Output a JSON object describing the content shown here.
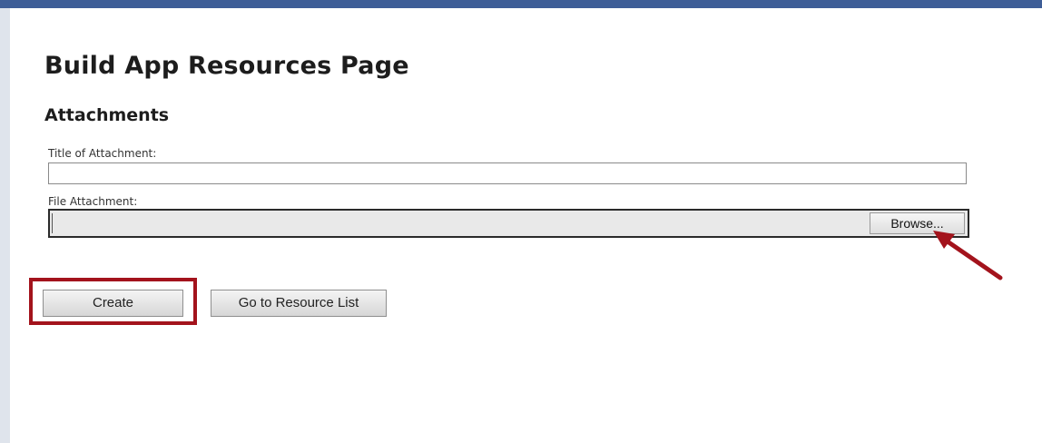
{
  "page": {
    "title": "Build App Resources Page",
    "section": "Attachments"
  },
  "form": {
    "title_label": "Title of Attachment:",
    "title_value": "",
    "file_label": "File Attachment:",
    "file_value": "",
    "browse_label": "Browse..."
  },
  "actions": {
    "create_label": "Create",
    "resource_list_label": "Go to Resource List"
  },
  "annotations": {
    "highlight_target": "create-button",
    "arrow_target": "browse-button",
    "color": "#a3131c"
  },
  "colors": {
    "top_bar": "#3e5e97",
    "left_gutter": "#dfe4ec"
  }
}
